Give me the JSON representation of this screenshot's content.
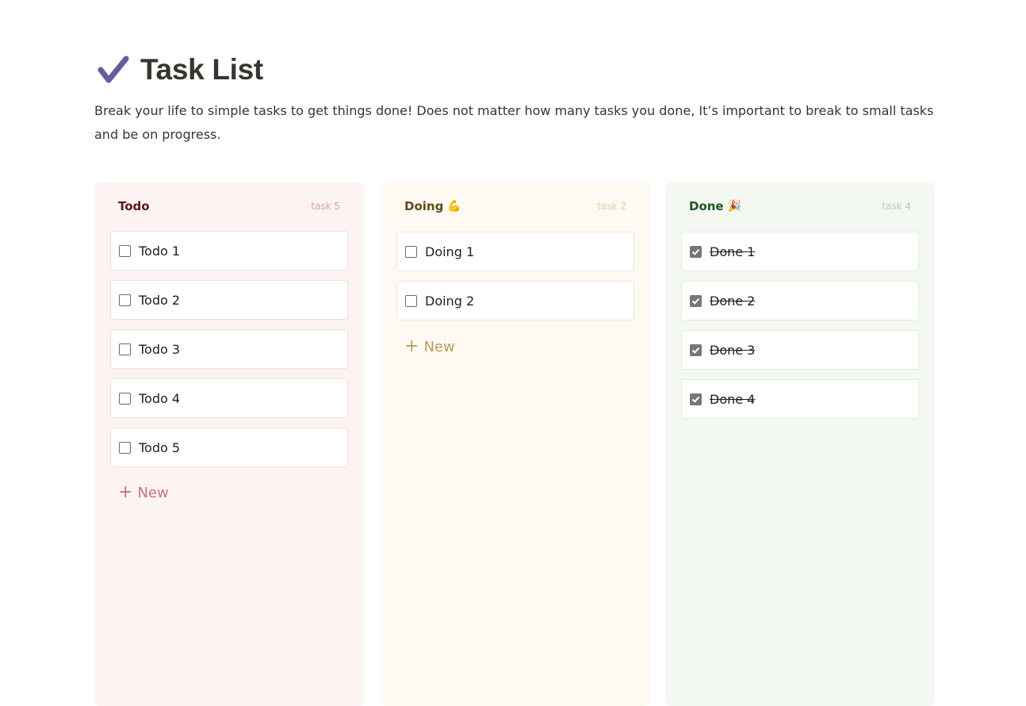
{
  "page": {
    "title": "Task List",
    "title_icon": "checkmark-icon",
    "description": "Break your life to simple tasks to get things done! Does not matter how many tasks you done, It’s important to break to small tasks and be on progress."
  },
  "colors": {
    "todo_bg": "#fdf3f3",
    "doing_bg": "#fefaf3",
    "done_bg": "#f4f8f3",
    "check_purple": "#6a5a9e"
  },
  "columns": {
    "todo": {
      "name": "Todo",
      "emoji": "",
      "count_label": "task 5",
      "new_label": "New",
      "cards": [
        {
          "label": "Todo 1",
          "checked": false
        },
        {
          "label": "Todo 2",
          "checked": false
        },
        {
          "label": "Todo 3",
          "checked": false
        },
        {
          "label": "Todo 4",
          "checked": false
        },
        {
          "label": "Todo 5",
          "checked": false
        }
      ]
    },
    "doing": {
      "name": "Doing",
      "emoji": "💪",
      "count_label": "task 2",
      "new_label": "New",
      "cards": [
        {
          "label": "Doing 1",
          "checked": false
        },
        {
          "label": "Doing 2",
          "checked": false
        }
      ]
    },
    "done": {
      "name": "Done",
      "emoji": "🎉",
      "count_label": "task 4",
      "cards": [
        {
          "label": "Done 1",
          "checked": true
        },
        {
          "label": "Done 2",
          "checked": true
        },
        {
          "label": "Done 3",
          "checked": true
        },
        {
          "label": "Done 4",
          "checked": true
        }
      ]
    }
  }
}
